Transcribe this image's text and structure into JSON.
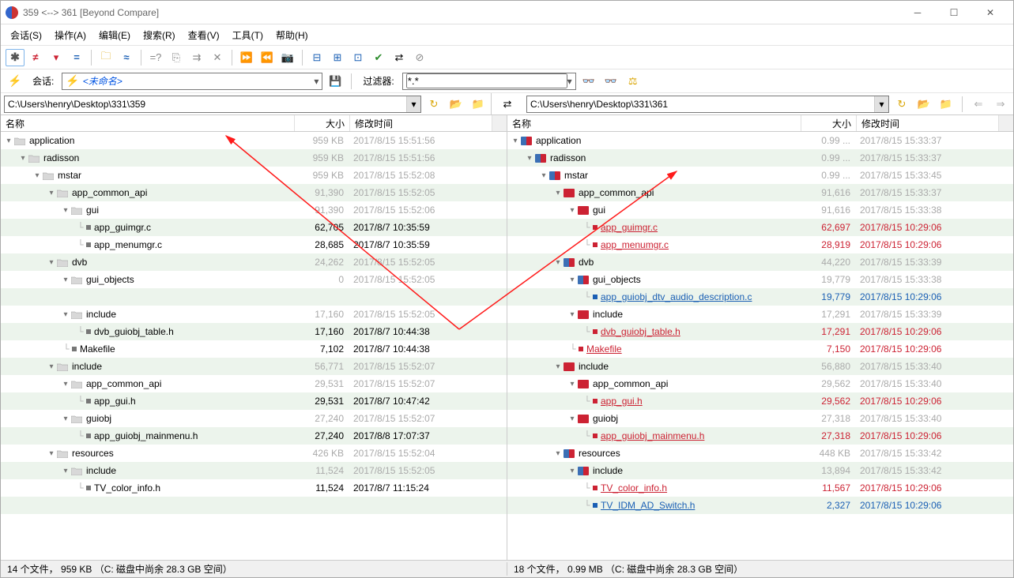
{
  "title": "359 <--> 361  [Beyond Compare]",
  "menu": {
    "session": "会话(S)",
    "actions": "操作(A)",
    "edit": "编辑(E)",
    "search": "搜索(R)",
    "view": "查看(V)",
    "tools": "工具(T)",
    "help": "帮助(H)"
  },
  "session_row": {
    "label": "会话:",
    "unnamed": "<未命名>",
    "filter_label": "过滤器:",
    "filter_value": "*.*"
  },
  "paths": {
    "left": "C:\\Users\\henry\\Desktop\\331\\359",
    "right": "C:\\Users\\henry\\Desktop\\331\\361"
  },
  "columns": {
    "name": "名称",
    "size": "大小",
    "date": "修改时间"
  },
  "left_rows": [
    {
      "indent": 0,
      "type": "folder-gray",
      "name": "application",
      "size": "959 KB",
      "date": "2017/8/15 15:51:56",
      "cls": "txt-gray",
      "dcls": "txt-gray",
      "ncls": "txt-black"
    },
    {
      "indent": 1,
      "type": "folder-gray",
      "name": "radisson",
      "size": "959 KB",
      "date": "2017/8/15 15:51:56",
      "cls": "txt-gray",
      "dcls": "txt-gray",
      "ncls": "txt-black"
    },
    {
      "indent": 2,
      "type": "folder-gray",
      "name": "mstar",
      "size": "959 KB",
      "date": "2017/8/15 15:52:08",
      "cls": "txt-gray",
      "dcls": "txt-gray",
      "ncls": "txt-black"
    },
    {
      "indent": 3,
      "type": "folder-gray",
      "name": "app_common_api",
      "size": "91,390",
      "date": "2017/8/15 15:52:05",
      "cls": "txt-gray",
      "dcls": "txt-gray",
      "ncls": "txt-black"
    },
    {
      "indent": 4,
      "type": "folder-gray",
      "name": "gui",
      "size": "91,390",
      "date": "2017/8/15 15:52:06",
      "cls": "txt-gray",
      "dcls": "txt-gray",
      "ncls": "txt-black"
    },
    {
      "indent": 5,
      "type": "file",
      "sq": "sq-gray",
      "name": "app_guimgr.c",
      "size": "62,705",
      "date": "2017/8/7 10:35:59",
      "cls": "txt-black",
      "dcls": "txt-black",
      "ncls": "txt-black"
    },
    {
      "indent": 5,
      "type": "file",
      "sq": "sq-gray",
      "name": "app_menumgr.c",
      "size": "28,685",
      "date": "2017/8/7 10:35:59",
      "cls": "txt-black",
      "dcls": "txt-black",
      "ncls": "txt-black"
    },
    {
      "indent": 3,
      "type": "folder-gray",
      "name": "dvb",
      "size": "24,262",
      "date": "2017/8/15 15:52:05",
      "cls": "txt-gray",
      "dcls": "txt-gray",
      "ncls": "txt-black"
    },
    {
      "indent": 4,
      "type": "folder-gray",
      "name": "gui_objects",
      "size": "0",
      "date": "2017/8/15 15:52:05",
      "cls": "txt-gray",
      "dcls": "txt-gray",
      "ncls": "txt-black"
    },
    {
      "indent": 4,
      "type": "blank",
      "name": "",
      "size": "",
      "date": "",
      "cls": "",
      "dcls": "",
      "ncls": ""
    },
    {
      "indent": 4,
      "type": "folder-gray",
      "name": "include",
      "size": "17,160",
      "date": "2017/8/15 15:52:05",
      "cls": "txt-gray",
      "dcls": "txt-gray",
      "ncls": "txt-black"
    },
    {
      "indent": 5,
      "type": "file",
      "sq": "sq-gray",
      "name": "dvb_guiobj_table.h",
      "size": "17,160",
      "date": "2017/8/7 10:44:38",
      "cls": "txt-black",
      "dcls": "txt-black",
      "ncls": "txt-black"
    },
    {
      "indent": 4,
      "type": "file",
      "sq": "sq-gray",
      "name": "Makefile",
      "size": "7,102",
      "date": "2017/8/7 10:44:38",
      "cls": "txt-black",
      "dcls": "txt-black",
      "ncls": "txt-black"
    },
    {
      "indent": 3,
      "type": "folder-gray",
      "name": "include",
      "size": "56,771",
      "date": "2017/8/15 15:52:07",
      "cls": "txt-gray",
      "dcls": "txt-gray",
      "ncls": "txt-black"
    },
    {
      "indent": 4,
      "type": "folder-gray",
      "name": "app_common_api",
      "size": "29,531",
      "date": "2017/8/15 15:52:07",
      "cls": "txt-gray",
      "dcls": "txt-gray",
      "ncls": "txt-black"
    },
    {
      "indent": 5,
      "type": "file",
      "sq": "sq-gray",
      "name": "app_gui.h",
      "size": "29,531",
      "date": "2017/8/7 10:47:42",
      "cls": "txt-black",
      "dcls": "txt-black",
      "ncls": "txt-black"
    },
    {
      "indent": 4,
      "type": "folder-gray",
      "name": "guiobj",
      "size": "27,240",
      "date": "2017/8/15 15:52:07",
      "cls": "txt-gray",
      "dcls": "txt-gray",
      "ncls": "txt-black"
    },
    {
      "indent": 5,
      "type": "file",
      "sq": "sq-gray",
      "name": "app_guiobj_mainmenu.h",
      "size": "27,240",
      "date": "2017/8/8 17:07:37",
      "cls": "txt-black",
      "dcls": "txt-black",
      "ncls": "txt-black"
    },
    {
      "indent": 3,
      "type": "folder-gray",
      "name": "resources",
      "size": "426 KB",
      "date": "2017/8/15 15:52:04",
      "cls": "txt-gray",
      "dcls": "txt-gray",
      "ncls": "txt-black"
    },
    {
      "indent": 4,
      "type": "folder-gray",
      "name": "include",
      "size": "11,524",
      "date": "2017/8/15 15:52:05",
      "cls": "txt-gray",
      "dcls": "txt-gray",
      "ncls": "txt-black"
    },
    {
      "indent": 5,
      "type": "file",
      "sq": "sq-gray",
      "name": "TV_color_info.h",
      "size": "11,524",
      "date": "2017/8/7 11:15:24",
      "cls": "txt-black",
      "dcls": "txt-black",
      "ncls": "txt-black"
    },
    {
      "indent": 5,
      "type": "blank",
      "name": "",
      "size": "",
      "date": "",
      "cls": "",
      "dcls": "",
      "ncls": ""
    }
  ],
  "right_rows": [
    {
      "indent": 0,
      "type": "folder-bluered",
      "name": "application",
      "size": "0.99 ...",
      "date": "2017/8/15 15:33:37",
      "cls": "txt-gray",
      "dcls": "txt-gray",
      "ncls": "txt-black"
    },
    {
      "indent": 1,
      "type": "folder-bluered",
      "name": "radisson",
      "size": "0.99 ...",
      "date": "2017/8/15 15:33:37",
      "cls": "txt-gray",
      "dcls": "txt-gray",
      "ncls": "txt-black"
    },
    {
      "indent": 2,
      "type": "folder-bluered",
      "name": "mstar",
      "size": "0.99 ...",
      "date": "2017/8/15 15:33:45",
      "cls": "txt-gray",
      "dcls": "txt-gray",
      "ncls": "txt-black"
    },
    {
      "indent": 3,
      "type": "folder-red",
      "name": "app_common_api",
      "size": "91,616",
      "date": "2017/8/15 15:33:37",
      "cls": "txt-gray",
      "dcls": "txt-gray",
      "ncls": "txt-black"
    },
    {
      "indent": 4,
      "type": "folder-red",
      "name": "gui",
      "size": "91,616",
      "date": "2017/8/15 15:33:38",
      "cls": "txt-gray",
      "dcls": "txt-gray",
      "ncls": "txt-black"
    },
    {
      "indent": 5,
      "type": "file",
      "sq": "sq-red",
      "name": "app_guimgr.c",
      "size": "62,697",
      "date": "2017/8/15 10:29:06",
      "cls": "txt-red-nou",
      "dcls": "txt-red-nou",
      "ncls": "txt-red"
    },
    {
      "indent": 5,
      "type": "file",
      "sq": "sq-red",
      "name": "app_menumgr.c",
      "size": "28,919",
      "date": "2017/8/15 10:29:06",
      "cls": "txt-red-nou",
      "dcls": "txt-red-nou",
      "ncls": "txt-red"
    },
    {
      "indent": 3,
      "type": "folder-bluered",
      "name": "dvb",
      "size": "44,220",
      "date": "2017/8/15 15:33:39",
      "cls": "txt-gray",
      "dcls": "txt-gray",
      "ncls": "txt-black"
    },
    {
      "indent": 4,
      "type": "folder-bluered",
      "name": "gui_objects",
      "size": "19,779",
      "date": "2017/8/15 15:33:38",
      "cls": "txt-gray",
      "dcls": "txt-gray",
      "ncls": "txt-black"
    },
    {
      "indent": 5,
      "type": "file",
      "sq": "sq-blue",
      "name": "app_guiobj_dtv_audio_description.c",
      "size": "19,779",
      "date": "2017/8/15 10:29:06",
      "cls": "txt-blue-nou",
      "dcls": "txt-blue-nou",
      "ncls": "txt-blue"
    },
    {
      "indent": 4,
      "type": "folder-red",
      "name": "include",
      "size": "17,291",
      "date": "2017/8/15 15:33:39",
      "cls": "txt-gray",
      "dcls": "txt-gray",
      "ncls": "txt-black"
    },
    {
      "indent": 5,
      "type": "file",
      "sq": "sq-red",
      "name": "dvb_guiobj_table.h",
      "size": "17,291",
      "date": "2017/8/15 10:29:06",
      "cls": "txt-red-nou",
      "dcls": "txt-red-nou",
      "ncls": "txt-red"
    },
    {
      "indent": 4,
      "type": "file",
      "sq": "sq-red",
      "name": "Makefile",
      "size": "7,150",
      "date": "2017/8/15 10:29:06",
      "cls": "txt-red-nou",
      "dcls": "txt-red-nou",
      "ncls": "txt-red"
    },
    {
      "indent": 3,
      "type": "folder-red",
      "name": "include",
      "size": "56,880",
      "date": "2017/8/15 15:33:40",
      "cls": "txt-gray",
      "dcls": "txt-gray",
      "ncls": "txt-black"
    },
    {
      "indent": 4,
      "type": "folder-red",
      "name": "app_common_api",
      "size": "29,562",
      "date": "2017/8/15 15:33:40",
      "cls": "txt-gray",
      "dcls": "txt-gray",
      "ncls": "txt-black"
    },
    {
      "indent": 5,
      "type": "file",
      "sq": "sq-red",
      "name": "app_gui.h",
      "size": "29,562",
      "date": "2017/8/15 10:29:06",
      "cls": "txt-red-nou",
      "dcls": "txt-red-nou",
      "ncls": "txt-red"
    },
    {
      "indent": 4,
      "type": "folder-red",
      "name": "guiobj",
      "size": "27,318",
      "date": "2017/8/15 15:33:40",
      "cls": "txt-gray",
      "dcls": "txt-gray",
      "ncls": "txt-black"
    },
    {
      "indent": 5,
      "type": "file",
      "sq": "sq-red",
      "name": "app_guiobj_mainmenu.h",
      "size": "27,318",
      "date": "2017/8/15 10:29:06",
      "cls": "txt-red-nou",
      "dcls": "txt-red-nou",
      "ncls": "txt-red"
    },
    {
      "indent": 3,
      "type": "folder-bluered",
      "name": "resources",
      "size": "448 KB",
      "date": "2017/8/15 15:33:42",
      "cls": "txt-gray",
      "dcls": "txt-gray",
      "ncls": "txt-black"
    },
    {
      "indent": 4,
      "type": "folder-bluered",
      "name": "include",
      "size": "13,894",
      "date": "2017/8/15 15:33:42",
      "cls": "txt-gray",
      "dcls": "txt-gray",
      "ncls": "txt-black"
    },
    {
      "indent": 5,
      "type": "file",
      "sq": "sq-red",
      "name": "TV_color_info.h",
      "size": "11,567",
      "date": "2017/8/15 10:29:06",
      "cls": "txt-red-nou",
      "dcls": "txt-red-nou",
      "ncls": "txt-red"
    },
    {
      "indent": 5,
      "type": "file",
      "sq": "sq-blue",
      "name": "TV_IDM_AD_Switch.h",
      "size": "2,327",
      "date": "2017/8/15 10:29:06",
      "cls": "txt-blue-nou",
      "dcls": "txt-blue-nou",
      "ncls": "txt-blue"
    }
  ],
  "status": {
    "left": "14 个文件， 959 KB （C: 磁盘中尚余 28.3 GB 空间）",
    "right": "18 个文件， 0.99 MB （C: 磁盘中尚余 28.3 GB 空间）"
  }
}
